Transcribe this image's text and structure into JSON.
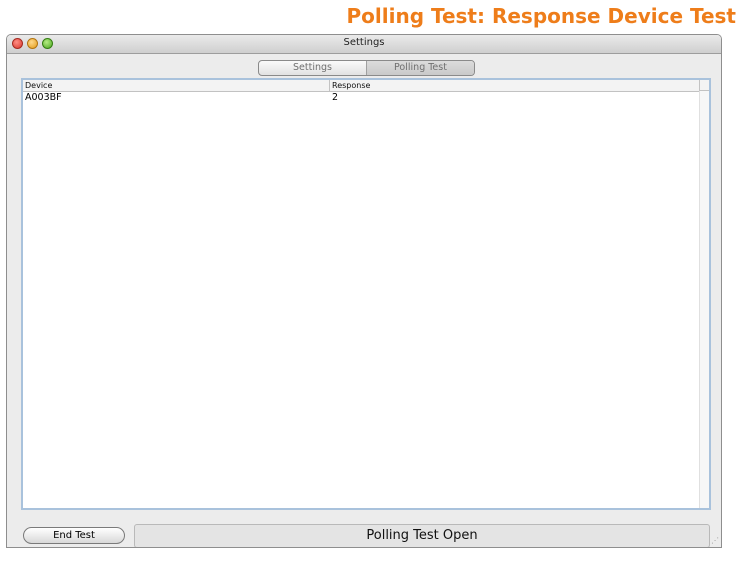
{
  "page": {
    "heading": "Polling Test: Response Device Test"
  },
  "window": {
    "title": "Settings",
    "tabs": [
      {
        "label": "Settings",
        "selected": false
      },
      {
        "label": "Polling Test",
        "selected": true
      }
    ]
  },
  "table": {
    "columns": [
      "Device",
      "Response"
    ],
    "rows": [
      {
        "device": "A003BF",
        "response": "2"
      }
    ]
  },
  "footer": {
    "end_button_label": "End Test",
    "status_text": "Polling Test Open"
  },
  "colors": {
    "heading": "#ee7d1a",
    "table_border": "#a9c2dc"
  }
}
